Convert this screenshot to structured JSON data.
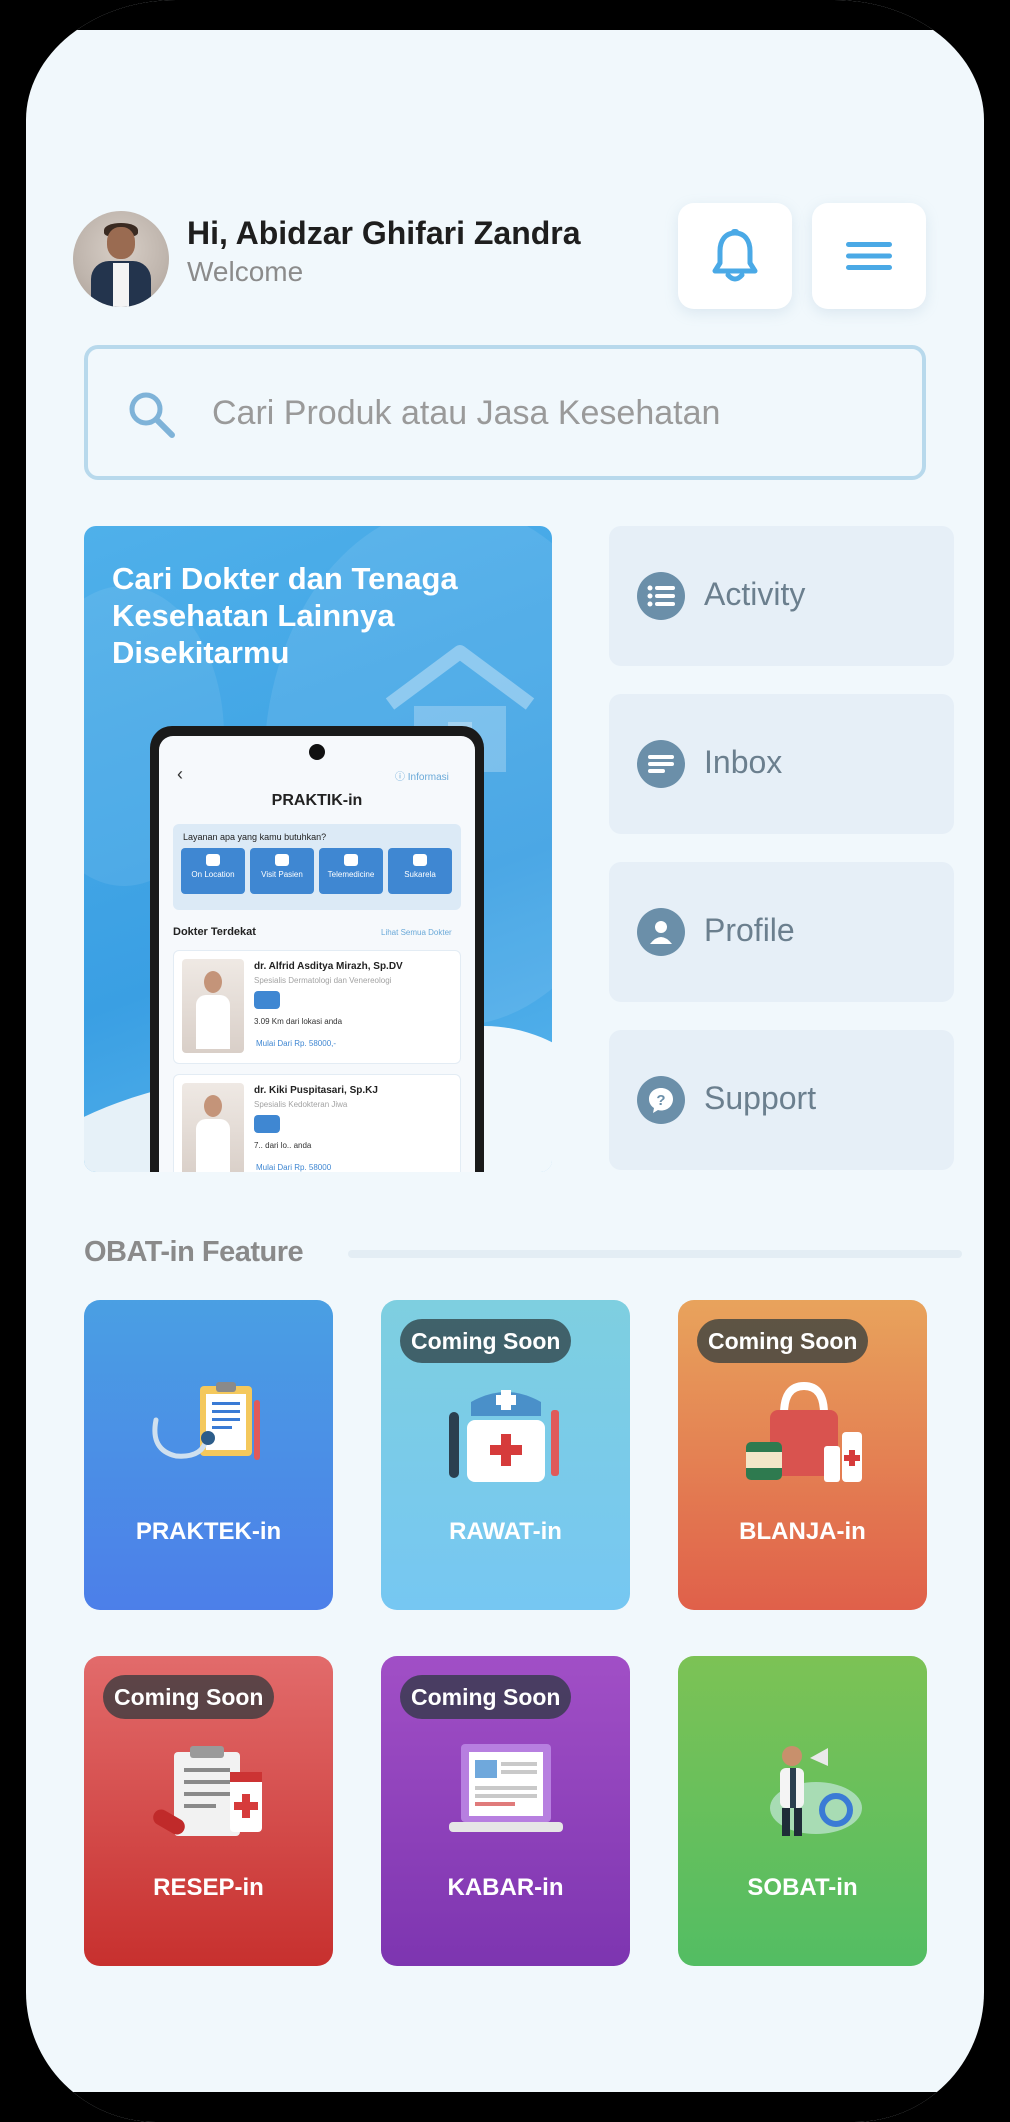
{
  "header": {
    "greeting": "Hi, Abidzar Ghifari Zandra",
    "subtitle": "Welcome"
  },
  "search": {
    "placeholder": "Cari Produk atau Jasa Kesehatan"
  },
  "banner": {
    "title": "Cari Dokter dan Tenaga Kesehatan Lainnya Disekitarmu",
    "mock": {
      "info": "ⓘ Informasi",
      "title": "PRAKTIK-in",
      "question": "Layanan apa yang kamu butuhkan?",
      "services": [
        "On Location",
        "Visit Pasien",
        "Telemedicine",
        "Sukarela"
      ],
      "nearby": "Dokter Terdekat",
      "see_all": "Lihat Semua Dokter",
      "doctors": [
        {
          "name": "dr. Alfrid Asditya Mirazh, Sp.DV",
          "specialty": "Spesialis Dermatologi dan Venereologi",
          "distance": "3.09 Km dari lokasi anda",
          "price": "Mulai Dari Rp. 58000,-"
        },
        {
          "name": "dr. Kiki Puspitasari, Sp.KJ",
          "specialty": "Spesialis Kedokteran Jiwa",
          "distance": "7.. dari lo.. anda",
          "price": "Mulai Dari Rp. 58000"
        }
      ]
    }
  },
  "side_menu": [
    {
      "label": "Activity",
      "icon": "list-icon"
    },
    {
      "label": "Inbox",
      "icon": "message-icon"
    },
    {
      "label": "Profile",
      "icon": "user-icon"
    },
    {
      "label": "Support",
      "icon": "help-icon"
    }
  ],
  "features": {
    "title": "OBAT-in Feature",
    "items": [
      {
        "label": "PRAKTEK-in",
        "badge": "",
        "icon": "stethoscope-clipboard-icon"
      },
      {
        "label": "RAWAT-in",
        "badge": "Coming Soon",
        "icon": "medical-kit-icon"
      },
      {
        "label": "BLANJA-in",
        "badge": "Coming Soon",
        "icon": "shopping-bag-icon"
      },
      {
        "label": "RESEP-in",
        "badge": "Coming Soon",
        "icon": "prescription-icon"
      },
      {
        "label": "KABAR-in",
        "badge": "Coming Soon",
        "icon": "news-laptop-icon"
      },
      {
        "label": "SOBAT-in",
        "badge": "",
        "icon": "community-person-icon"
      }
    ]
  },
  "colors": {
    "background": "#f1f8fc",
    "accent": "#4aa9e6",
    "side_icon": "#6b8fa9"
  }
}
